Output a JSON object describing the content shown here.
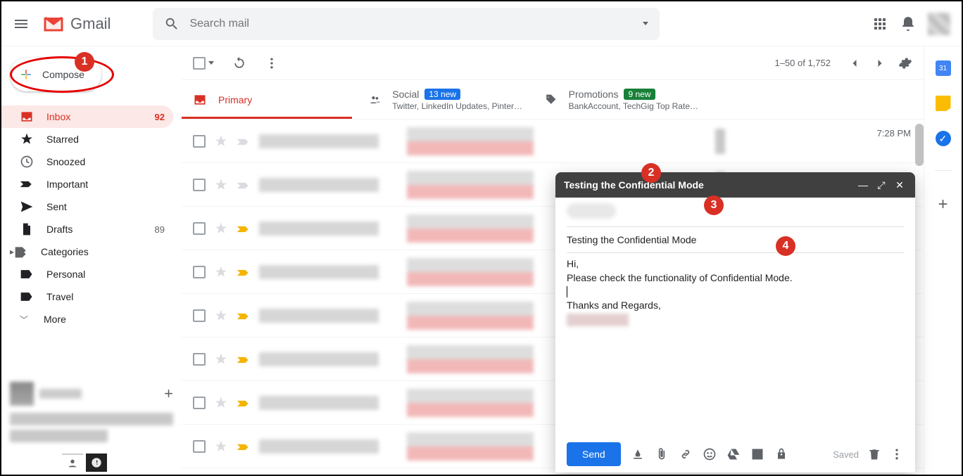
{
  "header": {
    "app_name": "Gmail",
    "search_placeholder": "Search mail"
  },
  "sidebar": {
    "compose_label": "Compose",
    "items": [
      {
        "label": "Inbox",
        "count": "92",
        "icon": "inbox",
        "active": true
      },
      {
        "label": "Starred",
        "count": "",
        "icon": "star"
      },
      {
        "label": "Snoozed",
        "count": "",
        "icon": "clock"
      },
      {
        "label": "Important",
        "count": "",
        "icon": "important"
      },
      {
        "label": "Sent",
        "count": "",
        "icon": "sent"
      },
      {
        "label": "Drafts",
        "count": "89",
        "icon": "draft"
      },
      {
        "label": "Categories",
        "count": "",
        "icon": "categories"
      },
      {
        "label": "Personal",
        "count": "",
        "icon": "label"
      },
      {
        "label": "Travel",
        "count": "",
        "icon": "label"
      },
      {
        "label": "More",
        "count": "",
        "icon": "more"
      }
    ]
  },
  "toolbar": {
    "pagination": "1–50 of 1,752"
  },
  "tabs": {
    "primary": {
      "label": "Primary"
    },
    "social": {
      "label": "Social",
      "badge": "13 new",
      "sub": "Twitter, LinkedIn Updates, Pinter…"
    },
    "promotions": {
      "label": "Promotions",
      "badge": "9 new",
      "sub": "BankAccount, TechGig Top Rate…"
    }
  },
  "mail_rows": [
    {
      "time": "7:28 PM",
      "important": "gray"
    },
    {
      "time": "",
      "important": "gray"
    },
    {
      "time": "",
      "important": "yellow"
    },
    {
      "time": "",
      "important": "yellow"
    },
    {
      "time": "",
      "important": "yellow"
    },
    {
      "time": "",
      "important": "yellow"
    },
    {
      "time": "",
      "important": "yellow"
    },
    {
      "time": "",
      "important": "yellow"
    }
  ],
  "compose_window": {
    "title": "Testing the Confidential Mode",
    "subject": "Testing the Confidential Mode",
    "body_l1": "Hi,",
    "body_l2": "Please check the functionality of Confidential Mode.",
    "body_l3": "Thanks and Regards,",
    "send_label": "Send",
    "saved_label": "Saved"
  },
  "rightbar": {
    "cal": "31"
  },
  "markers": [
    "1",
    "2",
    "3",
    "4"
  ]
}
